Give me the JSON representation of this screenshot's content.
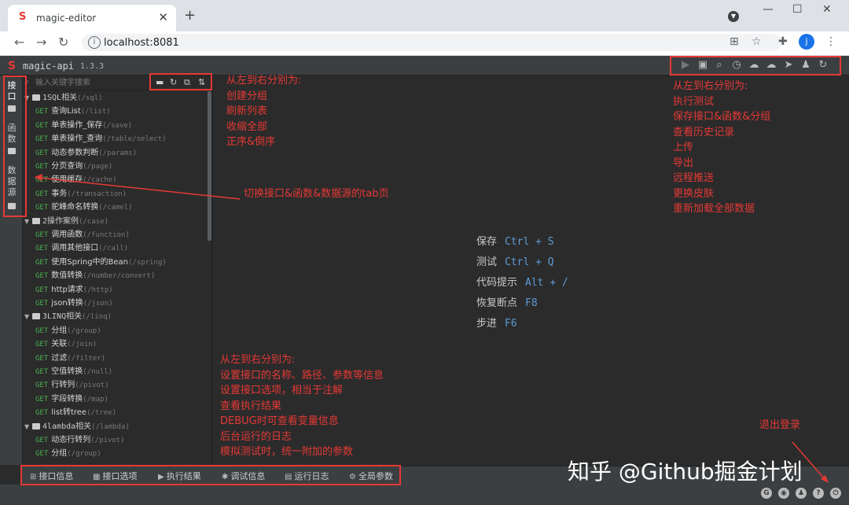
{
  "browser": {
    "tab_title": "magic-editor",
    "url": "localhost:8081",
    "profile_initial": "j"
  },
  "app": {
    "name": "magic-api",
    "version": "1.3.3",
    "search_placeholder": "输入关键字搜索",
    "vertical_tabs": [
      "接口",
      "函数",
      "数据源"
    ]
  },
  "tree": [
    {
      "type": "group",
      "name": "1SQL相关",
      "path": "(/sql)"
    },
    {
      "type": "api",
      "method": "GET",
      "name": "查询List",
      "path": "(/list)"
    },
    {
      "type": "api",
      "method": "GET",
      "name": "单表操作_保存",
      "path": "(/save)"
    },
    {
      "type": "api",
      "method": "GET",
      "name": "单表操作_查询",
      "path": "(/table/select)"
    },
    {
      "type": "api",
      "method": "GET",
      "name": "动态参数判断",
      "path": "(/params)"
    },
    {
      "type": "api",
      "method": "GET",
      "name": "分页查询",
      "path": "(/page)"
    },
    {
      "type": "api",
      "method": "GET",
      "name": "使用缓存",
      "path": "(/cache)"
    },
    {
      "type": "api",
      "method": "GET",
      "name": "事务",
      "path": "(/transaction)"
    },
    {
      "type": "api",
      "method": "GET",
      "name": "驼峰命名转换",
      "path": "(/camel)"
    },
    {
      "type": "group",
      "name": "2操作案例",
      "path": "(/case)"
    },
    {
      "type": "api",
      "method": "GET",
      "name": "调用函数",
      "path": "(/function)"
    },
    {
      "type": "api",
      "method": "GET",
      "name": "调用其他接口",
      "path": "(/call)"
    },
    {
      "type": "api",
      "method": "GET",
      "name": "使用Spring中的Bean",
      "path": "(/spring)"
    },
    {
      "type": "api",
      "method": "GET",
      "name": "数值转换",
      "path": "(/number/convert)"
    },
    {
      "type": "api",
      "method": "GET",
      "name": "http请求",
      "path": "(/http)"
    },
    {
      "type": "api",
      "method": "GET",
      "name": "json转换",
      "path": "(/json)"
    },
    {
      "type": "group",
      "name": "3LINQ相关",
      "path": "(/linq)"
    },
    {
      "type": "api",
      "method": "GET",
      "name": "分组",
      "path": "(/group)"
    },
    {
      "type": "api",
      "method": "GET",
      "name": "关联",
      "path": "(/join)"
    },
    {
      "type": "api",
      "method": "GET",
      "name": "过滤",
      "path": "(/filter)"
    },
    {
      "type": "api",
      "method": "GET",
      "name": "空值转换",
      "path": "(/null)"
    },
    {
      "type": "api",
      "method": "GET",
      "name": "行转列",
      "path": "(/pivot)"
    },
    {
      "type": "api",
      "method": "GET",
      "name": "字段转换",
      "path": "(/map)"
    },
    {
      "type": "api",
      "method": "GET",
      "name": "list转tree",
      "path": "(/tree)"
    },
    {
      "type": "group",
      "name": "4lambda相关",
      "path": "(/lambda)"
    },
    {
      "type": "api",
      "method": "GET",
      "name": "动态行转列",
      "path": "(/pivot)"
    },
    {
      "type": "api",
      "method": "GET",
      "name": "分组",
      "path": "(/group)"
    }
  ],
  "shortcuts": [
    {
      "label": "保存",
      "keys": "Ctrl + S"
    },
    {
      "label": "测试",
      "keys": "Ctrl + Q"
    },
    {
      "label": "代码提示",
      "keys": "Alt + /"
    },
    {
      "label": "恢复断点",
      "keys": "F8"
    },
    {
      "label": "步进",
      "keys": "F6"
    }
  ],
  "bottom_tabs": [
    "接口信息",
    "接口选项",
    "执行结果",
    "调试信息",
    "运行日志",
    "全局参数"
  ],
  "annotations": {
    "tree_tools": [
      "从左到右分别为:",
      "创建分组",
      "刷新列表",
      "收缩全部",
      "正序&倒序"
    ],
    "top_tools": [
      "从左到右分别为:",
      "执行测试",
      "保存接口&函数&分组",
      "查看历史记录",
      "上传",
      "导出",
      "远程推送",
      "更换皮肤",
      "重新加载全部数据"
    ],
    "tabs_note": "切换接口&函数&数据源的tab页",
    "bottom_tools": [
      "从左到右分别为:",
      "设置接口的名称、路径、参数等信息",
      "设置接口选项，相当于注解",
      "查看执行结果",
      "DEBUG时可查看变量信息",
      "后台运行的日志",
      "模拟测试时，统一附加的参数"
    ],
    "logout": "退出登录"
  },
  "watermark": "知乎 @Github掘金计划",
  "colors": {
    "annotation": "#e53935",
    "get_method": "#4caf50",
    "shortcut_key": "#5c9cd6",
    "app_bg": "#2b2b2b"
  }
}
